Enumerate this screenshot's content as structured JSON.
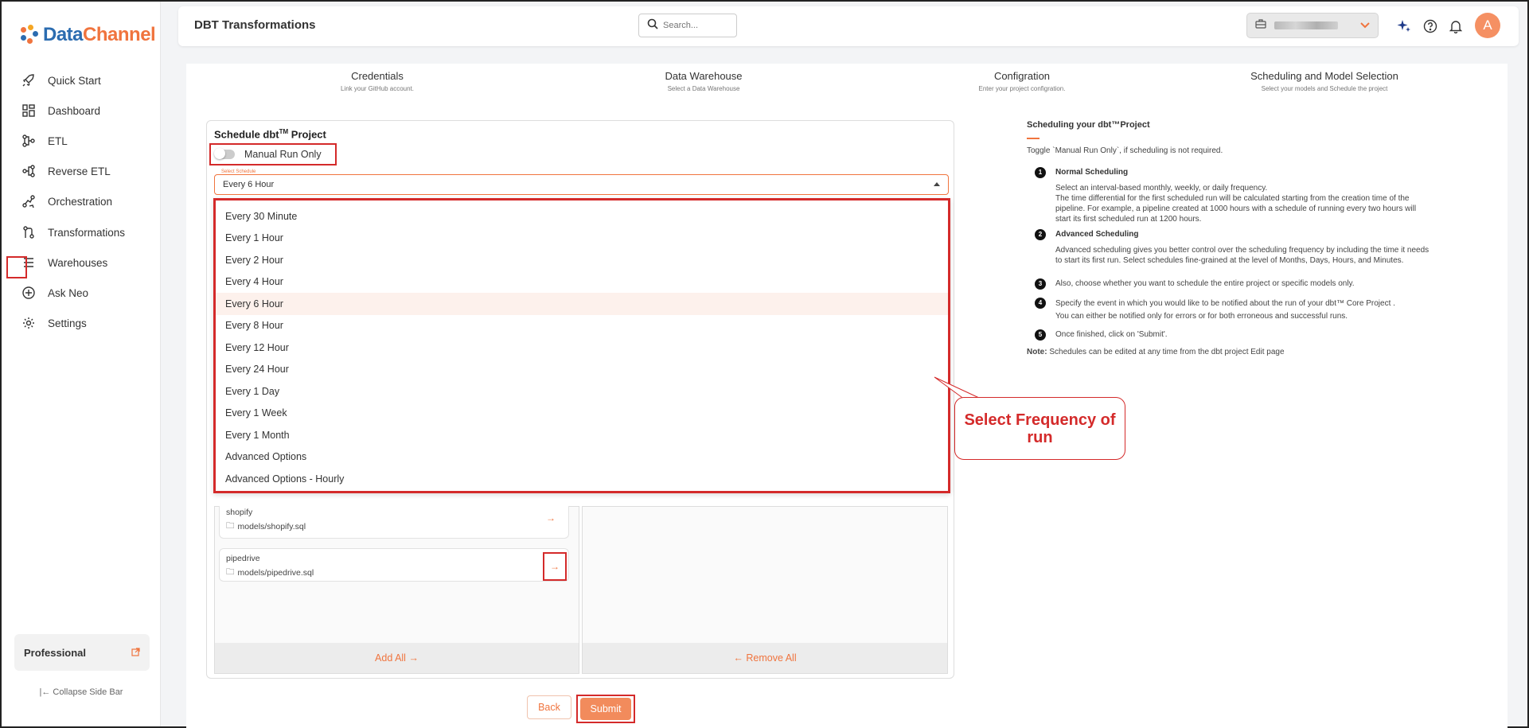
{
  "brand": {
    "logo_part1": "Data",
    "logo_part2": "Channel"
  },
  "sidebar": {
    "items": [
      {
        "label": "Quick Start",
        "icon": "rocket-icon"
      },
      {
        "label": "Dashboard",
        "icon": "dashboard-icon"
      },
      {
        "label": "ETL",
        "icon": "etl-icon"
      },
      {
        "label": "Reverse ETL",
        "icon": "reverse-etl-icon"
      },
      {
        "label": "Orchestration",
        "icon": "orchestration-icon"
      },
      {
        "label": "Transformations",
        "icon": "transformations-icon"
      },
      {
        "label": "Warehouses",
        "icon": "warehouses-icon"
      },
      {
        "label": "Ask Neo",
        "icon": "ask-neo-icon"
      },
      {
        "label": "Settings",
        "icon": "gear-icon"
      }
    ],
    "plan_label": "Professional",
    "collapse_label": "Collapse Side Bar"
  },
  "header": {
    "title": "DBT Transformations",
    "search_placeholder": "Search...",
    "avatar_initial": "A"
  },
  "steps": [
    {
      "title": "Credentials",
      "subtitle": "Link your GitHub account."
    },
    {
      "title": "Data Warehouse",
      "subtitle": "Select a Data Warehouse"
    },
    {
      "title": "Configration",
      "subtitle": "Enter your project configration."
    },
    {
      "title": "Scheduling and Model Selection",
      "subtitle": "Select your models and Schedule the project"
    }
  ],
  "schedule": {
    "title": "Schedule dbt",
    "title_sup": "TM",
    "title_suffix": " Project",
    "manual_run_label": "Manual Run Only",
    "select_label": "Select Schedule",
    "selected_value": "Every 6 Hour",
    "options": [
      "Every 30 Minute",
      "Every 1 Hour",
      "Every 2 Hour",
      "Every 4 Hour",
      "Every 6 Hour",
      "Every 8 Hour",
      "Every 12 Hour",
      "Every 24 Hour",
      "Every 1 Day",
      "Every 1 Week",
      "Every 1 Month",
      "Advanced Options",
      "Advanced Options - Hourly"
    ],
    "selected_index": 4
  },
  "models": [
    {
      "name": "shopify",
      "path": "models/shopify.sql"
    },
    {
      "name": "pipedrive",
      "path": "models/pipedrive.sql"
    }
  ],
  "add_all_label": "Add All",
  "remove_all_label": "Remove All",
  "buttons": {
    "back": "Back",
    "submit": "Submit"
  },
  "help": {
    "title": "Scheduling your dbt™Project",
    "intro": "Toggle `Manual Run Only`, if scheduling is not required.",
    "items": [
      {
        "num": "1",
        "head": "Normal Scheduling",
        "text": "Select an interval-based monthly, weekly, or daily frequency.\nThe time differential for the first scheduled run will be calculated starting from the creation time of the pipeline. For example, a pipeline created at 1000 hours with a schedule of running every two hours will start its first scheduled run at 1200 hours."
      },
      {
        "num": "2",
        "head": "Advanced Scheduling",
        "text": "Advanced scheduling gives you better control over the scheduling frequency by including the time it needs to start its first run. Select schedules fine-grained at the level of Months, Days, Hours, and Minutes."
      },
      {
        "num": "3",
        "head": "",
        "text": "Also, choose whether you want to schedule the entire project or specific models only."
      },
      {
        "num": "4",
        "head": "",
        "text": "Specify the event in which you would like to be notified about the run of your dbt™ Core Project .\nYou can either be notified only for errors or for both erroneous and successful runs."
      },
      {
        "num": "5",
        "head": "",
        "text": "Once finished, click on 'Submit'."
      }
    ],
    "note_label": "Note:",
    "note_text": " Schedules can be edited at any time from the dbt project Edit page"
  },
  "callout": "Select Frequency of run",
  "colors": {
    "accent": "#f0743e",
    "annotation_red": "#d42a2a",
    "brand_blue": "#2b6cb0"
  }
}
